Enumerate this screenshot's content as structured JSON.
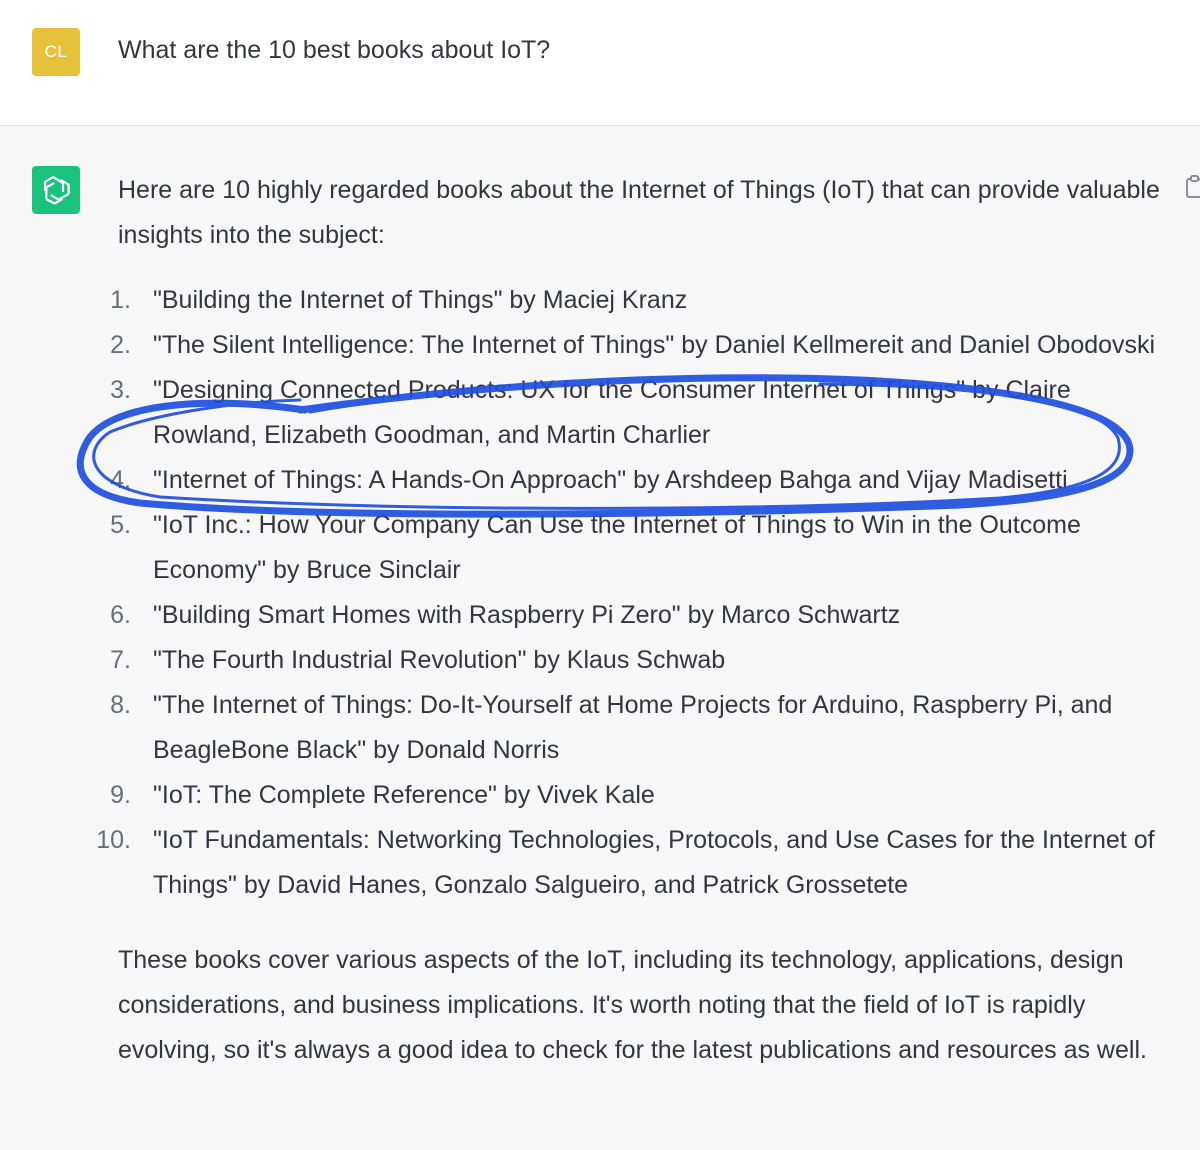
{
  "user": {
    "avatar_initials": "CL",
    "avatar_color": "#e6c23a",
    "message": "What are the 10 best books about IoT?"
  },
  "assistant": {
    "avatar_icon": "openai-logo-icon",
    "avatar_color": "#19c37d",
    "copy_icon": "clipboard-icon",
    "intro": "Here are 10 highly regarded books about the Internet of Things (IoT) that can provide valuable insights into the subject:",
    "books": [
      {
        "num": "1.",
        "text": "\"Building the Internet of Things\" by Maciej Kranz"
      },
      {
        "num": "2.",
        "text": "\"The Silent Intelligence: The Internet of Things\" by Daniel Kellmereit and Daniel Obodovski"
      },
      {
        "num": "3.",
        "text": "\"Designing Connected Products: UX for the Consumer Internet of Things\" by Claire Rowland, Elizabeth Goodman, and Martin Charlier"
      },
      {
        "num": "4.",
        "text": "\"Internet of Things: A Hands-On Approach\" by Arshdeep Bahga and Vijay Madisetti"
      },
      {
        "num": "5.",
        "text": "\"IoT Inc.: How Your Company Can Use the Internet of Things to Win in the Outcome Economy\" by Bruce Sinclair"
      },
      {
        "num": "6.",
        "text": "\"Building Smart Homes with Raspberry Pi Zero\" by Marco Schwartz"
      },
      {
        "num": "7.",
        "text": "\"The Fourth Industrial Revolution\" by Klaus Schwab"
      },
      {
        "num": "8.",
        "text": "\"The Internet of Things: Do-It-Yourself at Home Projects for Arduino, Raspberry Pi, and BeagleBone Black\" by Donald Norris"
      },
      {
        "num": "9.",
        "text": "\"IoT: The Complete Reference\" by Vivek Kale"
      },
      {
        "num": "10.",
        "text": "\"IoT Fundamentals: Networking Technologies, Protocols, and Use Cases for the Internet of Things\" by David Hanes, Gonzalo Salgueiro, and Patrick Grossetete"
      }
    ],
    "outro": "These books cover various aspects of the IoT, including its technology, applications, design considerations, and business implications. It's worth noting that the field of IoT is rapidly evolving, so it's always a good idea to check for the latest publications and resources as well."
  },
  "annotation": {
    "color": "#1f4fe0",
    "circled_item": "3."
  }
}
